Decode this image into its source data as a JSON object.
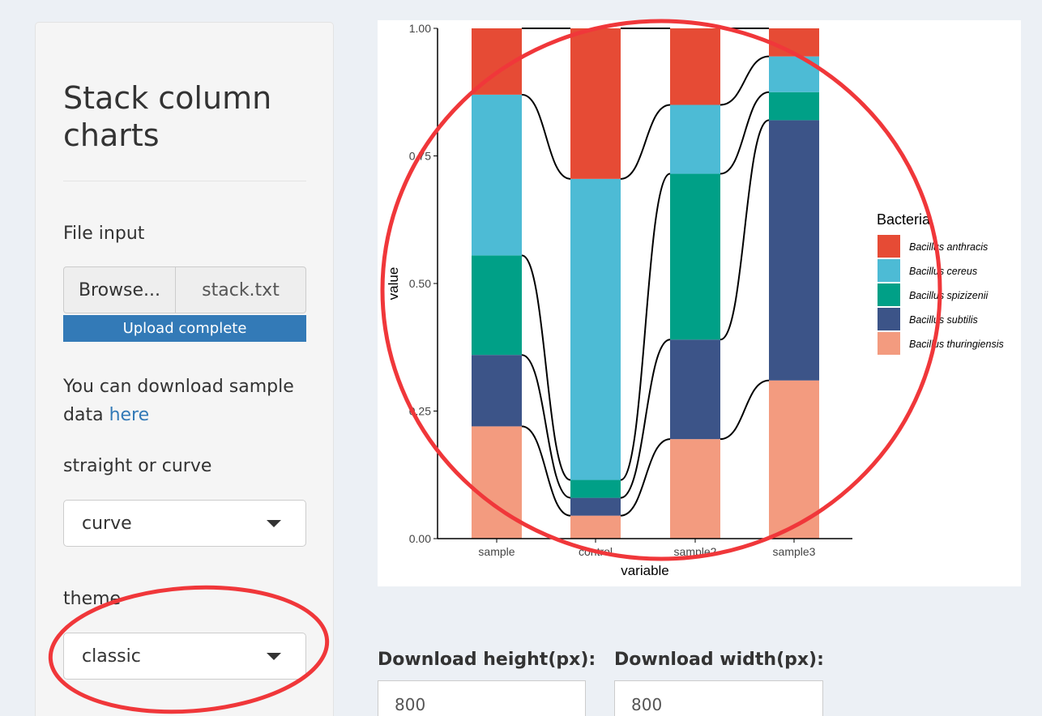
{
  "sidebar": {
    "title": "Stack column charts",
    "file_input": {
      "label": "File input",
      "browse_label": "Browse...",
      "file_name": "stack.txt",
      "progress_text": "Upload complete",
      "progress": 1.0
    },
    "download_text": "You can download sample data",
    "download_link": "here",
    "style_select": {
      "label": "straight or curve",
      "value": "curve"
    },
    "theme_select": {
      "label": "theme",
      "value": "classic"
    }
  },
  "download": {
    "height_label": "Download height(px):",
    "height_value": "800",
    "width_label": "Download width(px):",
    "width_value": "800"
  },
  "colors": {
    "accent": "#337ab7",
    "annotation": "#f0373a"
  },
  "chart_data": {
    "type": "bar",
    "stacked": true,
    "connector_lines": "curve",
    "categories": [
      "sample",
      "control",
      "sample2",
      "sample3"
    ],
    "xlabel": "variable",
    "ylabel": "value",
    "ylim": [
      0,
      1
    ],
    "yticks": [
      "0.00",
      "0.25",
      "0.50",
      "0.75",
      "1.00"
    ],
    "legend": {
      "title": "Bacteria",
      "position": "right"
    },
    "series": [
      {
        "name": "Bacillus thuringiensis",
        "color": "#f39b7f",
        "values": [
          0.22,
          0.045,
          0.195,
          0.31
        ]
      },
      {
        "name": "Bacillus subtilis",
        "color": "#3c5488",
        "values": [
          0.14,
          0.035,
          0.195,
          0.51
        ]
      },
      {
        "name": "Bacillus spizizenii",
        "color": "#00a087",
        "values": [
          0.195,
          0.035,
          0.325,
          0.055
        ]
      },
      {
        "name": "Bacillus cereus",
        "color": "#4dbbd5",
        "values": [
          0.315,
          0.59,
          0.135,
          0.07
        ]
      },
      {
        "name": "Bacillus anthracis",
        "color": "#e64b35",
        "values": [
          0.13,
          0.295,
          0.15,
          0.055
        ]
      }
    ]
  }
}
